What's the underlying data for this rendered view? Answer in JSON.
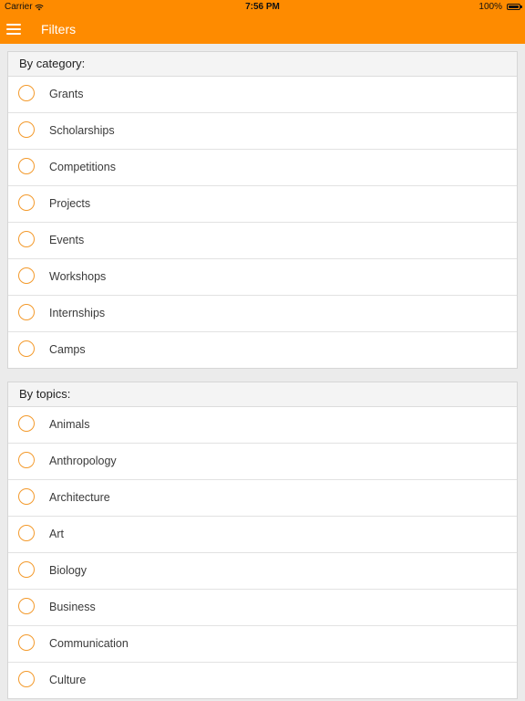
{
  "status_bar": {
    "carrier": "Carrier",
    "time": "7:56 PM",
    "battery": "100%"
  },
  "nav": {
    "title": "Filters",
    "menu_icon": "hamburger-menu-icon"
  },
  "colors": {
    "accent": "#fe8b00",
    "radio_border": "#f39a2c"
  },
  "sections": [
    {
      "header": "By category:",
      "items": [
        "Grants",
        "Scholarships",
        "Competitions",
        "Projects",
        "Events",
        "Workshops",
        "Internships",
        "Camps"
      ]
    },
    {
      "header": "By topics:",
      "items": [
        "Animals",
        "Anthropology",
        "Architecture",
        "Art",
        "Biology",
        "Business",
        "Communication",
        "Culture"
      ]
    }
  ]
}
